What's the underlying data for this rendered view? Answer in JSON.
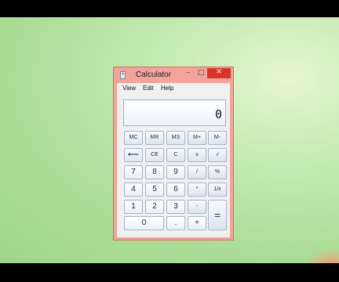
{
  "window": {
    "title": "Calculator"
  },
  "window_controls": {
    "minimize": "–",
    "maximize": "□",
    "close": "✕"
  },
  "menu": [
    "View",
    "Edit",
    "Help"
  ],
  "display": {
    "value": "0"
  },
  "keys": {
    "mc": "MC",
    "mr": "MR",
    "ms": "MS",
    "mplus": "M+",
    "mminus": "M-",
    "backspace": "⟵",
    "ce": "CE",
    "c": "C",
    "plusminus": "±",
    "sqrt": "√",
    "k7": "7",
    "k8": "8",
    "k9": "9",
    "div": "/",
    "pct": "%",
    "k4": "4",
    "k5": "5",
    "k6": "6",
    "mul": "*",
    "recip": "1/x",
    "k1": "1",
    "k2": "2",
    "k3": "3",
    "minus": "-",
    "equals": "=",
    "k0": "0",
    "dot": ".",
    "plus": "+"
  },
  "colors": {
    "titlebar": "#f2a49a",
    "close_button": "#d9342b",
    "desktop": "#a9dc95"
  }
}
